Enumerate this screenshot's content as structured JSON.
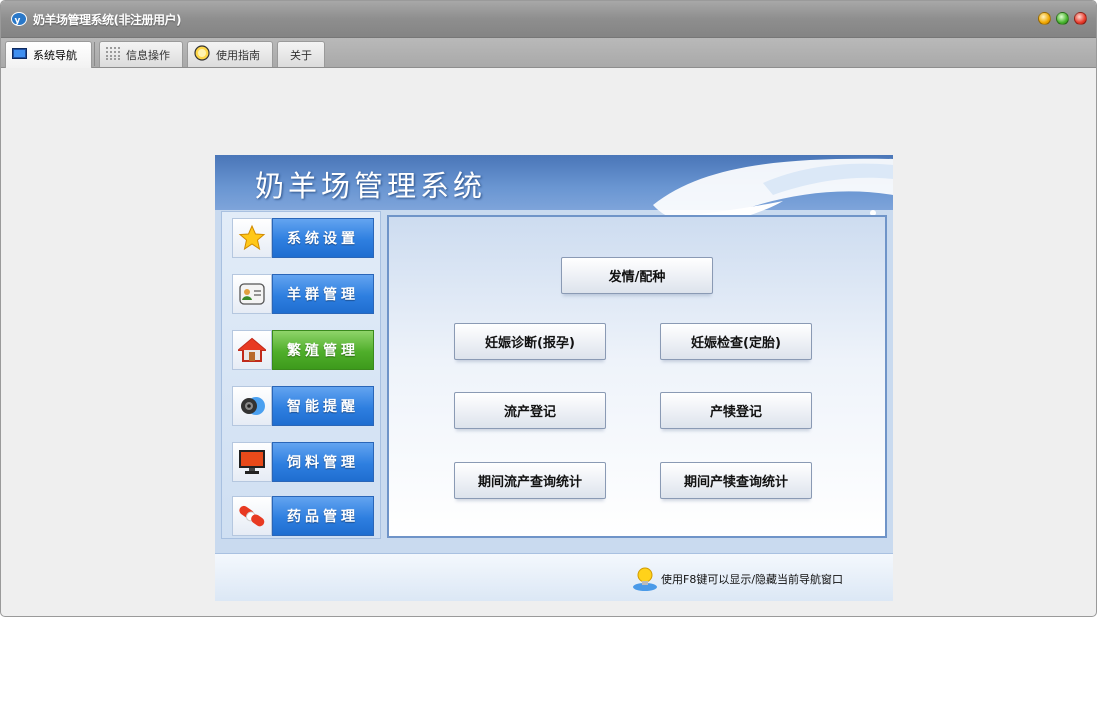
{
  "window": {
    "title": "奶羊场管理系统(非注册用户)"
  },
  "tabs": [
    {
      "label": "系统导航",
      "icon": "monitor-icon",
      "active": true
    },
    {
      "label": "信息操作",
      "icon": "grid-icon",
      "active": false
    },
    {
      "label": "使用指南",
      "icon": "guide-icon",
      "active": false
    },
    {
      "label": "关于",
      "icon": "",
      "active": false
    }
  ],
  "banner": {
    "title": "奶羊场管理系统"
  },
  "nav": [
    {
      "label": "系统设置",
      "icon": "star-icon",
      "active": false
    },
    {
      "label": "羊群管理",
      "icon": "contacts-icon",
      "active": false
    },
    {
      "label": "繁殖管理",
      "icon": "house-icon",
      "active": true
    },
    {
      "label": "智能提醒",
      "icon": "speaker-icon",
      "active": false
    },
    {
      "label": "饲料管理",
      "icon": "monitor-icon",
      "active": false
    },
    {
      "label": "药品管理",
      "icon": "pill-icon",
      "active": false
    }
  ],
  "functions": [
    {
      "label": "发情/配种"
    },
    {
      "label": "妊娠诊断(报孕)"
    },
    {
      "label": "妊娠检查(定胎)"
    },
    {
      "label": "流产登记"
    },
    {
      "label": "产犊登记"
    },
    {
      "label": "期间流产查询统计"
    },
    {
      "label": "期间产犊查询统计"
    }
  ],
  "footer": {
    "tip": "使用F8键可以显示/隐藏当前导航窗口"
  },
  "colors": {
    "nav_blue": "#2e7fe0",
    "nav_active_green": "#4fae2a",
    "banner_blue": "#4a76b8",
    "content_border": "#6f94c8"
  }
}
